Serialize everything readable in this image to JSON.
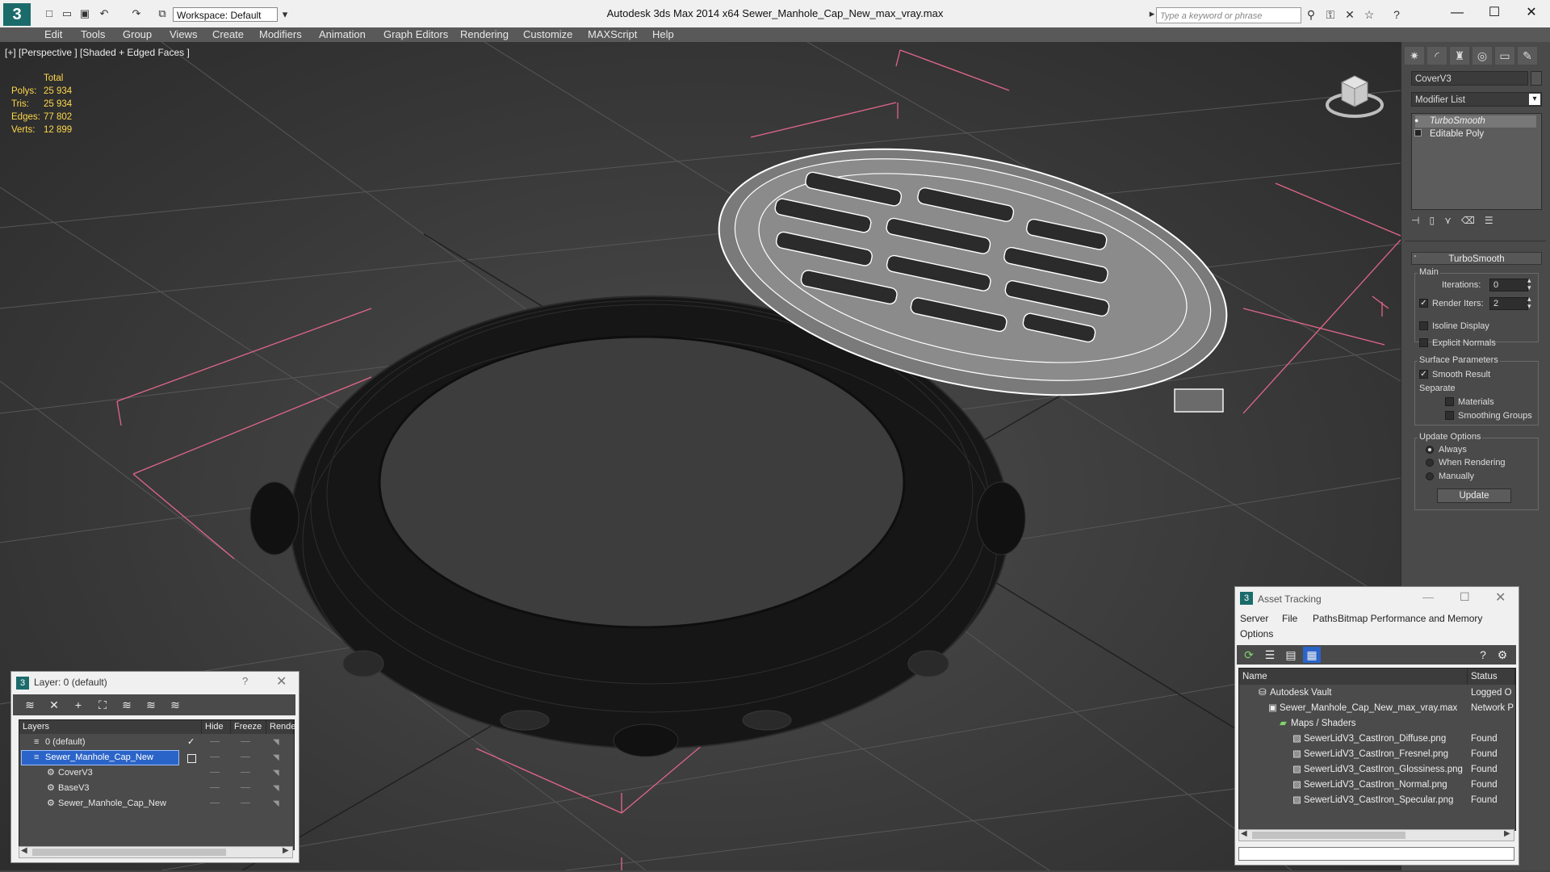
{
  "titlebar": {
    "title": "Autodesk 3ds Max  2014 x64     Sewer_Manhole_Cap_New_max_vray.max",
    "workspace": "Workspace: Default",
    "search_placeholder": "Type a keyword or phrase"
  },
  "menu": [
    "Edit",
    "Tools",
    "Group",
    "Views",
    "Create",
    "Modifiers",
    "Animation",
    "Graph Editors",
    "Rendering",
    "Customize",
    "MAXScript",
    "Help"
  ],
  "viewport": {
    "label": "[+] [Perspective ] [Shaded + Edged Faces ]",
    "stats": {
      "header": "Total",
      "rows": [
        {
          "label": "Polys:",
          "value": "25 934"
        },
        {
          "label": "Tris:",
          "value": "25 934"
        },
        {
          "label": "Edges:",
          "value": "77 802"
        },
        {
          "label": "Verts:",
          "value": "12 899"
        }
      ]
    }
  },
  "command_panel": {
    "object_name": "CoverV3",
    "modifier_list": "Modifier List",
    "stack": [
      "TurboSmooth",
      "Editable Poly"
    ],
    "rollout": "TurboSmooth",
    "main_group": "Main",
    "iterations_label": "Iterations:",
    "iterations_value": "0",
    "render_iters_label": "Render Iters:",
    "render_iters_value": "2",
    "isoline": "Isoline Display",
    "explicit_normals": "Explicit Normals",
    "surface_group": "Surface Parameters",
    "smooth_result": "Smooth Result",
    "separate": "Separate",
    "materials": "Materials",
    "smoothing_groups": "Smoothing Groups",
    "update_group": "Update Options",
    "always": "Always",
    "when_rendering": "When Rendering",
    "manually": "Manually",
    "update_button": "Update"
  },
  "layer_dialog": {
    "title": "Layer: 0 (default)",
    "help": "?",
    "columns": [
      "Layers",
      "Hide",
      "Freeze",
      "Rende"
    ],
    "rows": [
      {
        "name": "0 (default)",
        "selected": false
      },
      {
        "name": "Sewer_Manhole_Cap_New",
        "selected": true
      },
      {
        "name": "CoverV3",
        "selected": false
      },
      {
        "name": "BaseV3",
        "selected": false
      },
      {
        "name": "Sewer_Manhole_Cap_New",
        "selected": false
      }
    ]
  },
  "asset_tracking": {
    "title": "Asset Tracking",
    "menu": [
      "Server",
      "File",
      "Paths",
      "Bitmap Performance and Memory",
      "Options"
    ],
    "columns": [
      "Name",
      "Status"
    ],
    "rows": [
      {
        "name": "Autodesk Vault",
        "status": "Logged O"
      },
      {
        "name": "Sewer_Manhole_Cap_New_max_vray.max",
        "status": "Network P"
      },
      {
        "name": "Maps / Shaders",
        "status": ""
      },
      {
        "name": "SewerLidV3_CastIron_Diffuse.png",
        "status": "Found"
      },
      {
        "name": "SewerLidV3_CastIron_Fresnel.png",
        "status": "Found"
      },
      {
        "name": "SewerLidV3_CastIron_Glossiness.png",
        "status": "Found"
      },
      {
        "name": "SewerLidV3_CastIron_Normal.png",
        "status": "Found"
      },
      {
        "name": "SewerLidV3_CastIron_Specular.png",
        "status": "Found"
      }
    ]
  },
  "colors": {
    "accent": "#1c6b6b",
    "stats": "#ffd84a",
    "selection": "#2b64c8",
    "bounding_box": "#e0668a"
  }
}
